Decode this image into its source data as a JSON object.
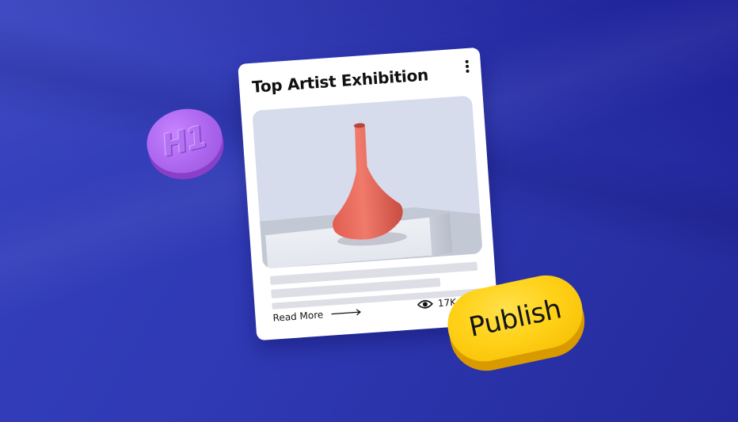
{
  "background": {
    "color": "#2f39b3"
  },
  "card": {
    "title": "Top Artist Exhibition",
    "menu_icon": "more-vertical-icon",
    "image": {
      "subject": "vase",
      "vase_color": "#e8675a",
      "backdrop_color": "#d7ddec"
    },
    "read_more_label": "Read More",
    "read_more_icon": "arrow-right-icon",
    "views_icon": "eye-icon",
    "views_text": "17K views"
  },
  "h1_badge": {
    "label": "H1",
    "color": "#b06bf2"
  },
  "publish_button": {
    "label": "Publish",
    "color": "#ffd21a"
  }
}
